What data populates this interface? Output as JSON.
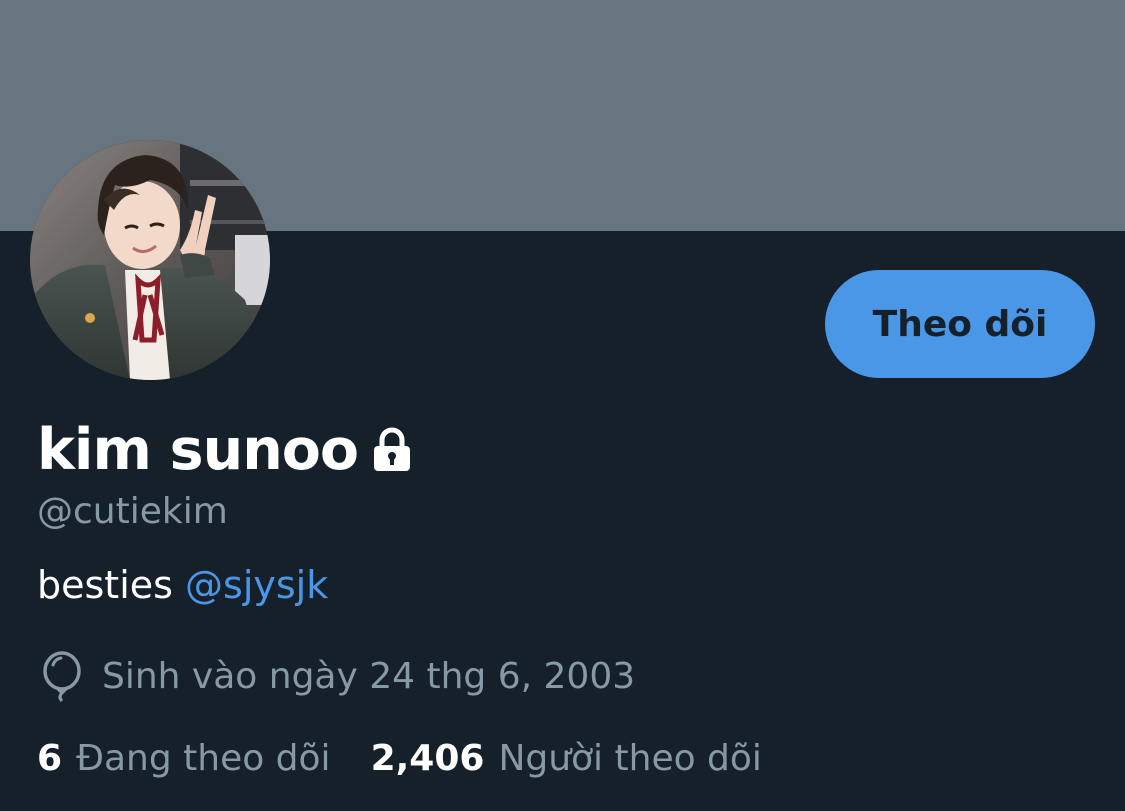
{
  "profile": {
    "display_name": "kim sunoo",
    "handle": "@cutiekim",
    "bio_text": "besties ",
    "bio_mention": "@sjysjk",
    "birth_date": "Sinh vào ngày 24 thg 6, 2003",
    "is_protected": true
  },
  "actions": {
    "follow_label": "Theo dõi"
  },
  "stats": {
    "following_count": "6",
    "following_label": "Đang theo dõi",
    "followers_count": "2,406",
    "followers_label": "Người theo dõi"
  },
  "icons": {
    "lock": "lock-icon",
    "birthday": "balloon-icon"
  },
  "colors": {
    "background": "#15202b",
    "banner": "#66757f",
    "accent": "#4a97e8",
    "secondary_text": "#8899a6",
    "primary_text": "#ffffff"
  }
}
